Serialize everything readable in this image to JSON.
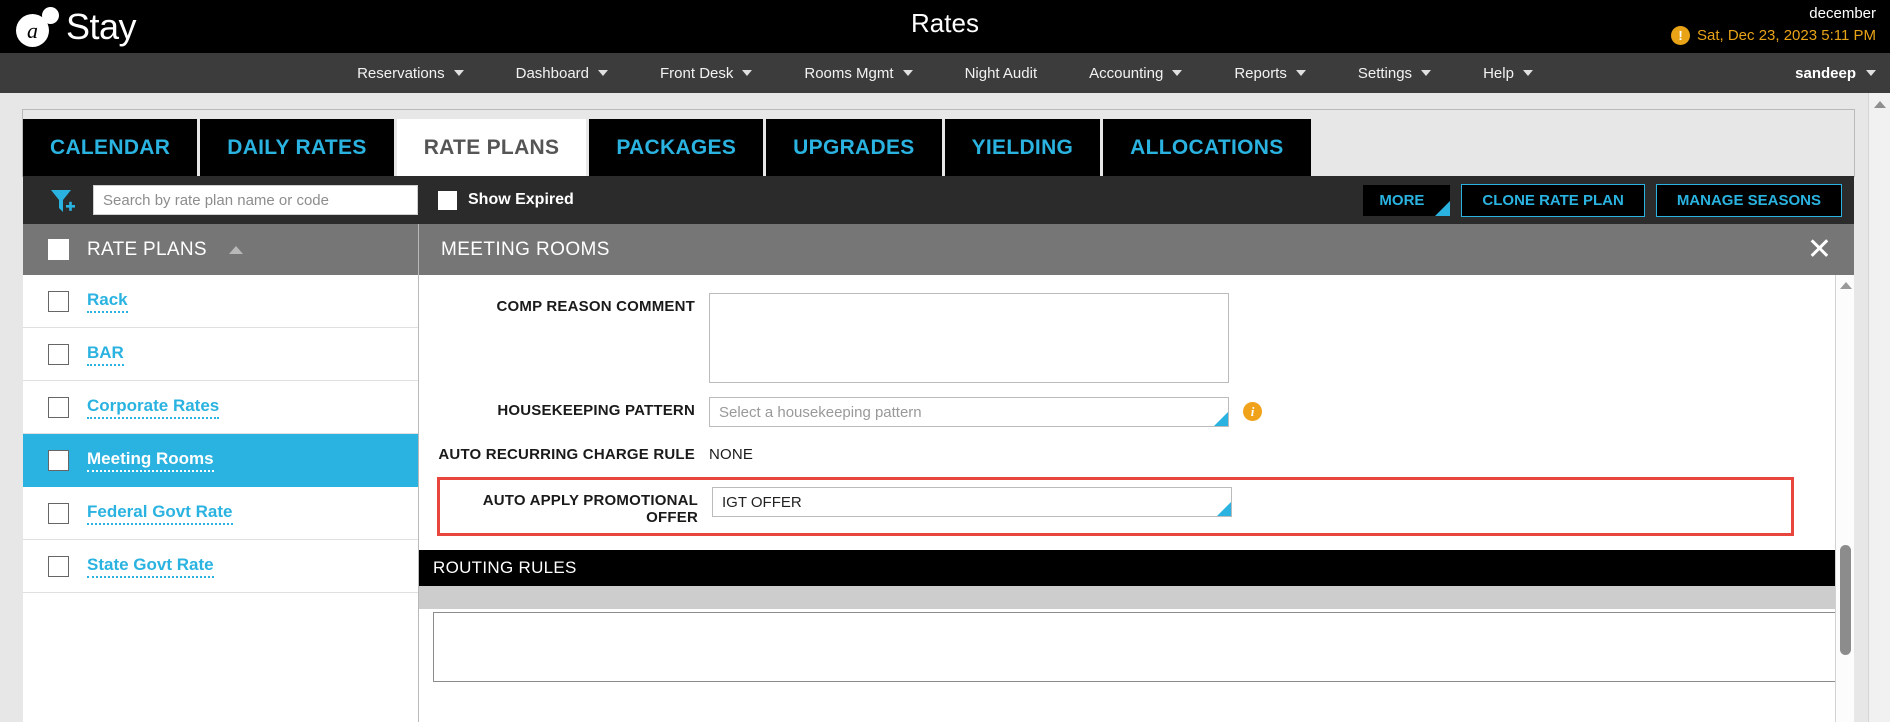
{
  "topbar": {
    "logo_letter": "a",
    "logo_text": "Stay",
    "page_title": "Rates",
    "hotel_name": "december",
    "datetime": "Sat, Dec 23, 2023 5:11 PM",
    "warning_icon": "exclamation-icon",
    "warning_glyph": "!"
  },
  "nav": {
    "items": [
      {
        "label": "Reservations",
        "has_caret": true
      },
      {
        "label": "Dashboard",
        "has_caret": true
      },
      {
        "label": "Front Desk",
        "has_caret": true
      },
      {
        "label": "Rooms Mgmt",
        "has_caret": true
      },
      {
        "label": "Night Audit",
        "has_caret": false
      },
      {
        "label": "Accounting",
        "has_caret": true
      },
      {
        "label": "Reports",
        "has_caret": true
      },
      {
        "label": "Settings",
        "has_caret": true
      },
      {
        "label": "Help",
        "has_caret": true
      }
    ],
    "user": "sandeep"
  },
  "tabs": [
    {
      "label": "CALENDAR",
      "active": false
    },
    {
      "label": "DAILY RATES",
      "active": false
    },
    {
      "label": "RATE PLANS",
      "active": true
    },
    {
      "label": "PACKAGES",
      "active": false
    },
    {
      "label": "UPGRADES",
      "active": false
    },
    {
      "label": "YIELDING",
      "active": false
    },
    {
      "label": "ALLOCATIONS",
      "active": false
    }
  ],
  "filterbar": {
    "funnel_icon": "filter-funnel-icon",
    "search_value": "",
    "search_placeholder": "Search by rate plan name or code",
    "show_expired_label": "Show Expired",
    "show_expired_checked": false,
    "more_label": "MORE",
    "clone_label": "CLONE RATE PLAN",
    "manage_seasons_label": "MANAGE SEASONS"
  },
  "rate_list": {
    "header_title": "RATE PLANS",
    "sort_icon": "caret-up-icon",
    "items": [
      {
        "label": "Rack",
        "selected": false
      },
      {
        "label": "BAR",
        "selected": false
      },
      {
        "label": "Corporate Rates",
        "selected": false
      },
      {
        "label": "Meeting Rooms",
        "selected": true
      },
      {
        "label": "Federal Govt Rate",
        "selected": false
      },
      {
        "label": "State Govt Rate",
        "selected": false
      }
    ]
  },
  "detail": {
    "title": "MEETING ROOMS",
    "close_icon": "close-icon",
    "close_glyph": "✕",
    "fields": {
      "comp_reason_comment": {
        "label": "COMP REASON COMMENT",
        "value": ""
      },
      "housekeeping_pattern": {
        "label": "HOUSEKEEPING PATTERN",
        "placeholder": "Select a housekeeping pattern",
        "value": "",
        "info_icon": "info-icon",
        "info_glyph": "i"
      },
      "auto_recurring_charge_rule": {
        "label": "AUTO RECURRING CHARGE RULE",
        "value": "NONE"
      },
      "auto_apply_promotional_offer": {
        "label": "AUTO APPLY PROMOTIONAL OFFER",
        "value": "IGT OFFER",
        "highlighted": true,
        "highlight_color": "#e8453c"
      }
    },
    "routing_rules_title": "ROUTING RULES"
  },
  "colors": {
    "accent_cyan": "#2ab3e0",
    "header_black": "#000000",
    "nav_gray": "#3c3c3c",
    "panel_gray": "#767676",
    "warning_orange": "#e8a317",
    "highlight_red": "#e8453c"
  }
}
